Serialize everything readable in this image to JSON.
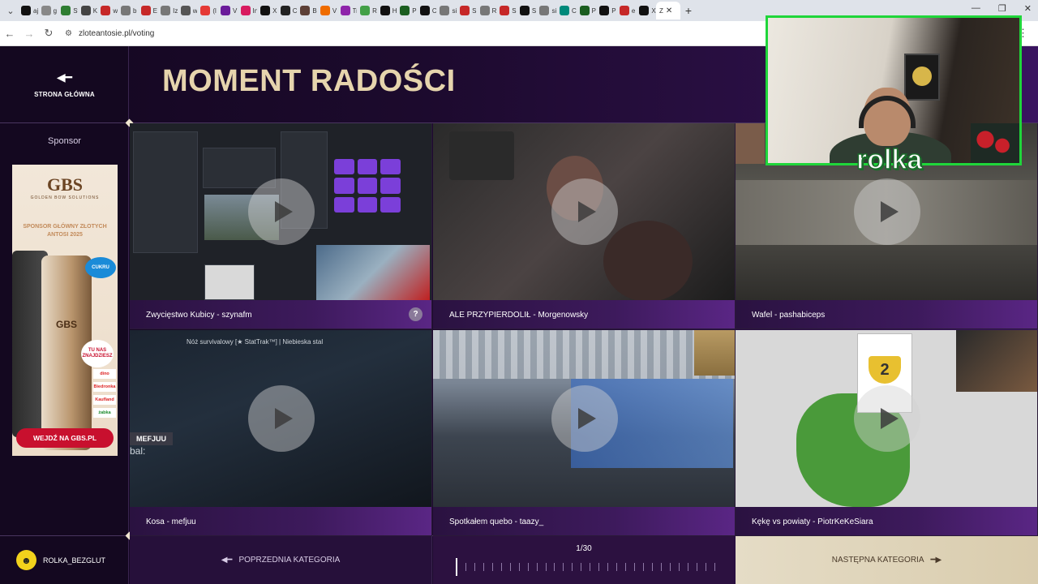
{
  "browser": {
    "url": "zloteantosie.pl/voting",
    "tabs": [
      {
        "title": "aj",
        "color": "#111111"
      },
      {
        "title": "g",
        "color": "#888888"
      },
      {
        "title": "St",
        "color": "#2e7d32"
      },
      {
        "title": "K",
        "color": "#444444"
      },
      {
        "title": "w",
        "color": "#c62828"
      },
      {
        "title": "b",
        "color": "#777777"
      },
      {
        "title": "E",
        "color": "#c62828"
      },
      {
        "title": "Iz",
        "color": "#777777"
      },
      {
        "title": "w",
        "color": "#555555"
      },
      {
        "title": "(l",
        "color": "#e53935"
      },
      {
        "title": "V",
        "color": "#6a1b9a"
      },
      {
        "title": "In",
        "color": "#d81b60"
      },
      {
        "title": "X",
        "color": "#111111"
      },
      {
        "title": "C",
        "color": "#222222"
      },
      {
        "title": "B",
        "color": "#5d4037"
      },
      {
        "title": "V",
        "color": "#ef6c00"
      },
      {
        "title": "Tr",
        "color": "#8e24aa"
      },
      {
        "title": "R",
        "color": "#43a047"
      },
      {
        "title": "H",
        "color": "#111111"
      },
      {
        "title": "P",
        "color": "#1b5e20"
      },
      {
        "title": "C",
        "color": "#111111"
      },
      {
        "title": "si",
        "color": "#777777"
      },
      {
        "title": "S",
        "color": "#c62828"
      },
      {
        "title": "R",
        "color": "#777777"
      },
      {
        "title": "S",
        "color": "#c62828"
      },
      {
        "title": "S",
        "color": "#111111"
      },
      {
        "title": "si",
        "color": "#777777"
      },
      {
        "title": "C",
        "color": "#00897b"
      },
      {
        "title": "P",
        "color": "#1b5e20"
      },
      {
        "title": "P",
        "color": "#111111"
      },
      {
        "title": "e",
        "color": "#c62828"
      },
      {
        "title": "X",
        "color": "#111111"
      }
    ],
    "active_tab_title": "Z"
  },
  "home": {
    "label": "STRONA GŁÓWNA"
  },
  "sponsor": {
    "label": "Sponsor",
    "ad": {
      "brand": "GBS",
      "brand_sub": "GOLDEN BOW SOLUTIONS",
      "tagline": "SPONSOR GŁÓWNY ZŁOTYCH ANTOSI 2025",
      "can_brand": "GBS",
      "no_sugar": "CUKRU",
      "badge": "TU NAS ZNAJDZIESZ",
      "stores": [
        "dino",
        "Biedronka",
        "Kaufland",
        "żabka"
      ],
      "cta": "WEJDŹ NA GBS.PL"
    }
  },
  "page_title": "MOMENT RADOŚCI",
  "clips": [
    {
      "title": "Zwycięstwo Kubicy - szynafm",
      "has_help": true,
      "help_label": "?"
    },
    {
      "title": "ALE PRZYPIERDOLIŁ - Morgenowsky"
    },
    {
      "title": "Wafel - pashabiceps"
    },
    {
      "title": "Kosa - mefjuu",
      "overlay_banner": "Nóż survivalowy [★ StatTrak™] | Niebieska stal",
      "overlay_tag": "MEFJUU",
      "overlay_text": "bal:"
    },
    {
      "title": "Spotkałem quebo - taazy_"
    },
    {
      "title": "Kękę vs powiaty - PiotrKeKeSiara",
      "overlay_number": "2"
    }
  ],
  "footer": {
    "username": "ROLKA_BEZGLUT",
    "prev_label": "POPRZEDNIA KATEGORIA",
    "next_label": "NASTĘPNA KATEGORIA",
    "pager_text": "1/30",
    "current_page": 1,
    "total_pages": 30
  },
  "webcam": {
    "name": "rolka"
  }
}
